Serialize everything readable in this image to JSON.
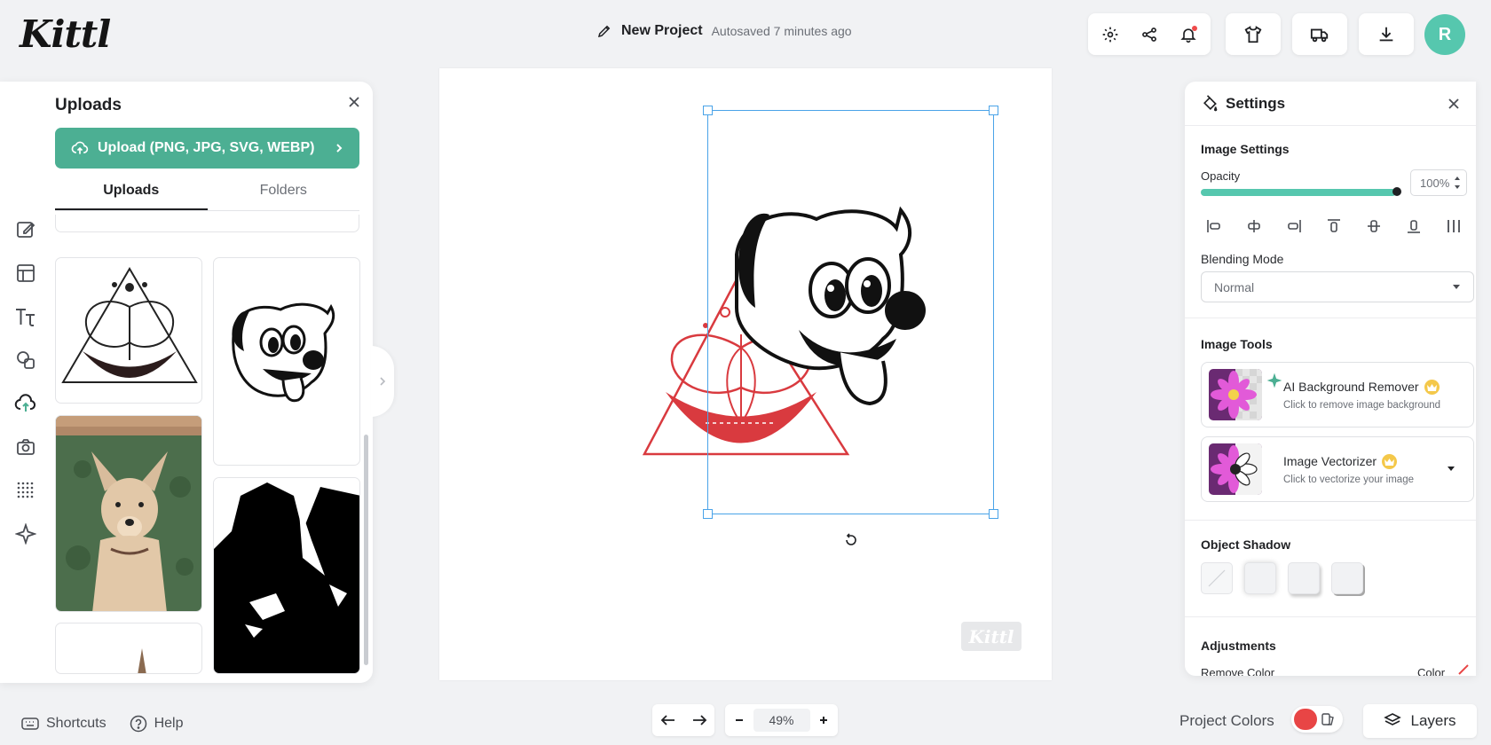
{
  "app": {
    "logo": "Kittl"
  },
  "header": {
    "project_name": "New Project",
    "autosave": "Autosaved 7 minutes ago",
    "avatar_initial": "R"
  },
  "uploads_panel": {
    "title": "Uploads",
    "upload_button": "Upload (PNG, JPG, SVG, WEBP)",
    "tabs": [
      "Uploads",
      "Folders"
    ]
  },
  "settings_panel": {
    "title": "Settings",
    "image_settings": "Image Settings",
    "opacity_label": "Opacity",
    "opacity_value": "100%",
    "opacity_level": 1.0,
    "blending_label": "Blending Mode",
    "blending_value": "Normal",
    "image_tools": "Image Tools",
    "tools": [
      {
        "title": "AI Background Remover",
        "desc": "Click to remove image background"
      },
      {
        "title": "Image Vectorizer",
        "desc": "Click to vectorize your image"
      }
    ],
    "object_shadow": "Object Shadow",
    "adjustments": "Adjustments",
    "remove_color": "Remove Color",
    "color": "Color"
  },
  "canvas": {
    "watermark": "Kittl"
  },
  "footer": {
    "shortcuts": "Shortcuts",
    "help": "Help",
    "zoom": "49%",
    "project_colors": "Project Colors",
    "layers": "Layers"
  },
  "colors": {
    "accent": "#4caf93",
    "avatar": "#56c7ae",
    "selection": "#4aa3e8",
    "design_red": "#d93a3f"
  }
}
